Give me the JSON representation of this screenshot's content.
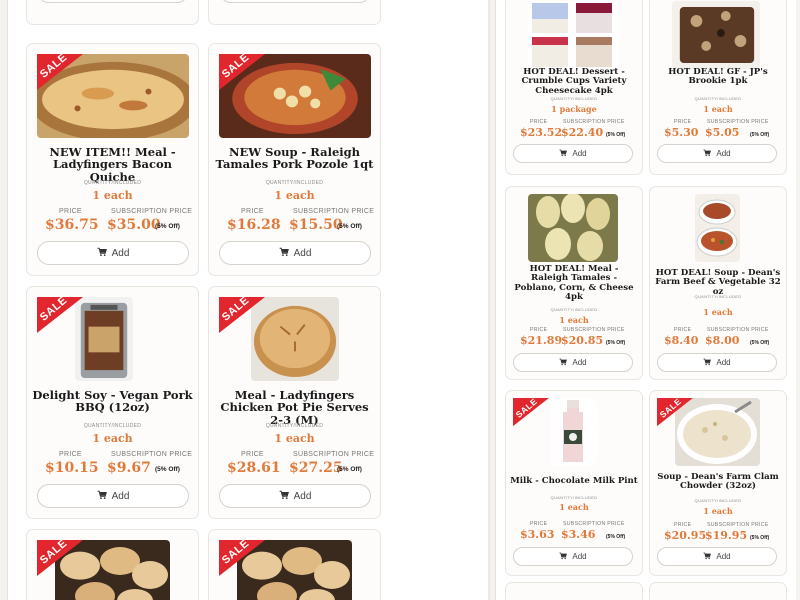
{
  "colors": {
    "accent": "#e07a3b",
    "sale": "#e1262d",
    "title": "#1a1a1a"
  },
  "sale_label": "SALE",
  "add_label": "Add",
  "quantity_label": "QUANTITY/INCLUDED",
  "price_label": "PRICE",
  "subscription_label": "SUBSCRIPTION PRICE",
  "off_label": "(5% Off)",
  "left_products": [
    {
      "title": "NEW ITEM!! Meal - Ladyfingers Bacon Quiche",
      "qty": "1 each",
      "price": "$36.75",
      "sub": "$35.00",
      "sale": true,
      "img": "quiche"
    },
    {
      "title": "NEW Soup - Raleigh Tamales Pork Pozole 1qt",
      "qty": "1 each",
      "price": "$16.28",
      "sub": "$15.50",
      "sale": true,
      "img": "pozole"
    },
    {
      "title": "Delight Soy - Vegan Pork BBQ (12oz)",
      "qty": "1 each",
      "price": "$10.15",
      "sub": "$9.67",
      "sale": true,
      "img": "bbq"
    },
    {
      "title": "Meal - Ladyfingers Chicken Pot Pie Serves 2-3 (M)",
      "qty": "1 each",
      "price": "$28.61",
      "sub": "$27.25",
      "sale": true,
      "img": "potpie"
    },
    {
      "title": "",
      "sale": true,
      "img": "dumplings"
    },
    {
      "title": "",
      "sale": true,
      "img": "dumplings"
    }
  ],
  "right_products": [
    {
      "title": "HOT DEAL! Dessert - Crumble Cups Variety Cheesecake 4pk",
      "qty": "1 package",
      "price": "$23.52",
      "sub": "$22.40",
      "sale": false,
      "img": "cups"
    },
    {
      "title": "HOT DEAL! GF - JP's Brookie 1pk",
      "qty": "1 each",
      "price": "$5.30",
      "sub": "$5.05",
      "sale": false,
      "img": "brookie"
    },
    {
      "title": "HOT DEAL! Meal - Raleigh Tamales - Poblano, Corn, & Cheese 4pk",
      "qty": "1 each",
      "price": "$21.89",
      "sub": "$20.85",
      "sale": false,
      "img": "tamales"
    },
    {
      "title": "HOT DEAL! Soup - Dean's Farm Beef & Vegetable 32 oz",
      "qty": "1 each",
      "price": "$8.40",
      "sub": "$8.00",
      "sale": false,
      "img": "beefsoup"
    },
    {
      "title": "Milk - Chocolate Milk Pint",
      "qty": "1 each",
      "price": "$3.63",
      "sub": "$3.46",
      "sale": true,
      "img": "milk"
    },
    {
      "title": "Soup - Dean's Farm Clam Chowder (32oz)",
      "qty": "1 each",
      "price": "$20.95",
      "sub": "$19.95",
      "sale": true,
      "img": "chowder"
    }
  ]
}
